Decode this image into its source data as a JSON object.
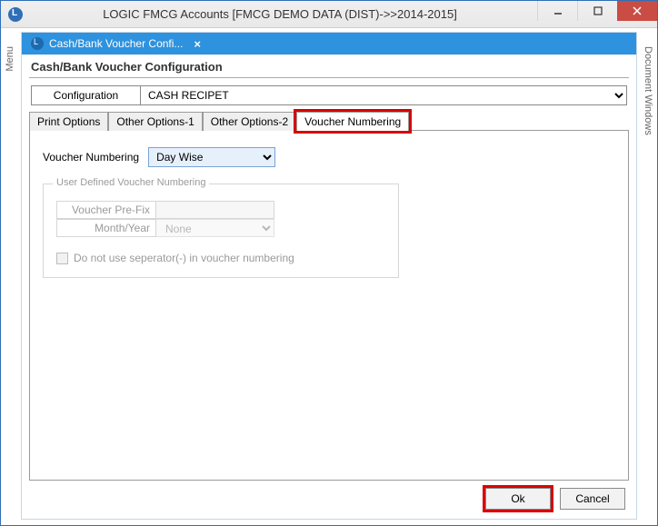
{
  "window": {
    "title": "LOGIC FMCG Accounts  [FMCG DEMO DATA (DIST)->>2014-2015]"
  },
  "side_tabs": {
    "left": "Menu",
    "right": "Document Windows"
  },
  "inner_tab": {
    "label": "Cash/Bank Voucher Confi..."
  },
  "page": {
    "title": "Cash/Bank Voucher Configuration"
  },
  "config": {
    "label": "Configuration",
    "selected": "CASH RECIPET"
  },
  "subtabs": {
    "items": [
      "Print Options",
      "Other Options-1",
      "Other Options-2",
      "Voucher Numbering"
    ],
    "active_index": 3
  },
  "voucher_numbering": {
    "label": "Voucher Numbering",
    "selected": "Day Wise"
  },
  "user_defined_group": {
    "legend": "User Defined Voucher Numbering",
    "prefix_label": "Voucher Pre-Fix",
    "prefix_value": "",
    "monthyear_label": "Month/Year",
    "monthyear_value": "None",
    "checkbox_label": "Do not use seperator(-) in voucher numbering"
  },
  "footer": {
    "ok": "Ok",
    "cancel": "Cancel"
  }
}
